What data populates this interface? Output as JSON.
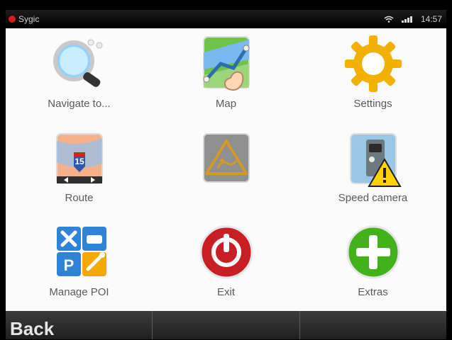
{
  "statusbar": {
    "app_name": "Sygic",
    "time": "14:57"
  },
  "menu": {
    "items": [
      {
        "label": "Navigate to...",
        "icon": "magnifier-search-icon"
      },
      {
        "label": "Map",
        "icon": "map-icon"
      },
      {
        "label": "Settings",
        "icon": "gear-icon"
      },
      {
        "label": "Route",
        "icon": "route-icon"
      },
      {
        "label": "",
        "icon": "road-warning-icon"
      },
      {
        "label": "Speed camera",
        "icon": "speed-camera-icon"
      },
      {
        "label": "Manage POI",
        "icon": "poi-icon"
      },
      {
        "label": "Exit",
        "icon": "power-icon"
      },
      {
        "label": "Extras",
        "icon": "plus-icon"
      }
    ]
  },
  "bottom": {
    "back_label": "Back",
    "mid_label": "",
    "right_label": ""
  },
  "colors": {
    "accent_red": "#d61b1b",
    "settings_yellow": "#f2b000",
    "extras_green": "#43b21a",
    "exit_red": "#c71f24",
    "poi_blue": "#2f83d6"
  }
}
